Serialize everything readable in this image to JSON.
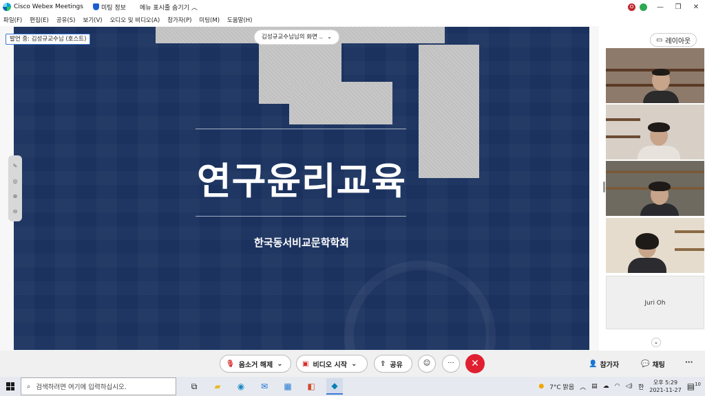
{
  "titlebar": {
    "app_title": "Cisco Webex Meetings",
    "meeting_info": "미팅 정보",
    "hide_menu": "메뉴 표시줄 숨기기",
    "status_user_initial": "O",
    "status_colors": {
      "recording": "#c0282d",
      "connection": "#2fa84f"
    }
  },
  "menu": {
    "items": [
      "파일(F)",
      "편집(E)",
      "공유(S)",
      "보기(V)",
      "오디오 및 비디오(A)",
      "참가자(P)",
      "미팅(M)",
      "도움말(H)"
    ]
  },
  "stage": {
    "speaker_label": "발언 중: 김성규교수님 (호스트)",
    "screen_selector": "김성규교수님님의 화면 ..",
    "slide_title": "연구윤리교육",
    "slide_subtitle": "한국동서비교문학학회",
    "slide_bg": "#1b325f"
  },
  "panel": {
    "layout_button": "레이아웃",
    "named_tile": "Juri Oh"
  },
  "controls": {
    "mute": "음소거 해제",
    "video": "비디오 시작",
    "share": "공유",
    "participants": "참가자",
    "chat": "채팅",
    "end_color": "#e02030"
  },
  "taskbar": {
    "search_placeholder": "검색하려면 여기에 입력하십시오.",
    "weather": "7°C  맑음",
    "time": "오후 5:29",
    "date": "2021-11-27",
    "notification_count": "10",
    "ime": "한"
  }
}
